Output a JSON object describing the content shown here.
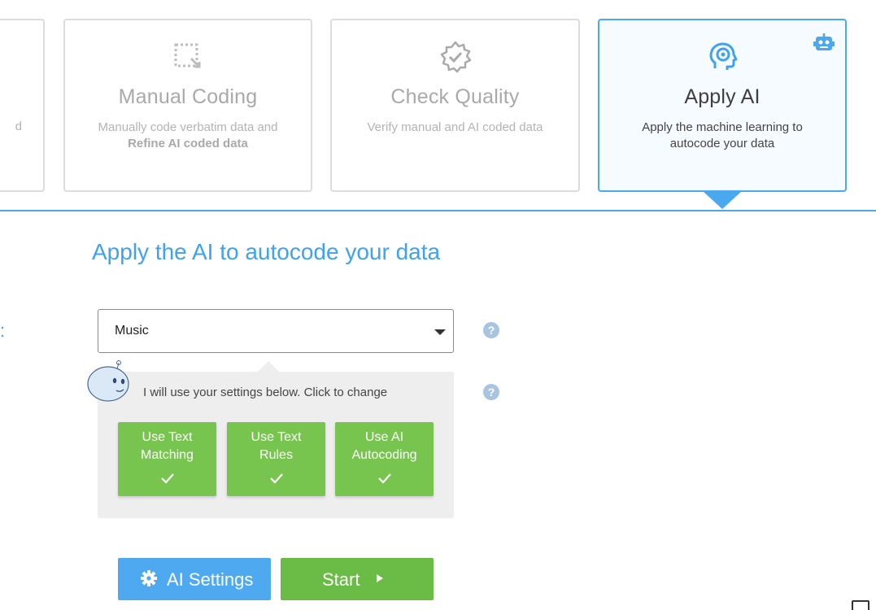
{
  "steps": {
    "left_fragment": "d",
    "manual": {
      "title": "Manual Coding",
      "desc_line1": "Manually code verbatim data and",
      "desc_line2": "Refine AI coded data"
    },
    "check": {
      "title": "Check Quality",
      "desc": "Verify manual and AI coded data"
    },
    "apply": {
      "title": "Apply AI",
      "desc_line1": "Apply the machine learning to",
      "desc_line2": "autocode your data"
    }
  },
  "main": {
    "heading": "Apply the AI to autocode your data",
    "label_fragment": ":",
    "select": {
      "value": "Music"
    },
    "help_label": "?",
    "assistant_message": "I will use your settings below. Click to change",
    "options": [
      {
        "line1": "Use Text",
        "line2": "Matching"
      },
      {
        "line1": "Use Text",
        "line2": "Rules"
      },
      {
        "line1": "Use AI",
        "line2": "Autocoding"
      }
    ]
  },
  "actions": {
    "settings_label": "AI Settings",
    "start_label": "Start"
  },
  "colors": {
    "accent": "#4aa8ef",
    "green": "#77c54f",
    "start_green": "#6bbb47"
  }
}
